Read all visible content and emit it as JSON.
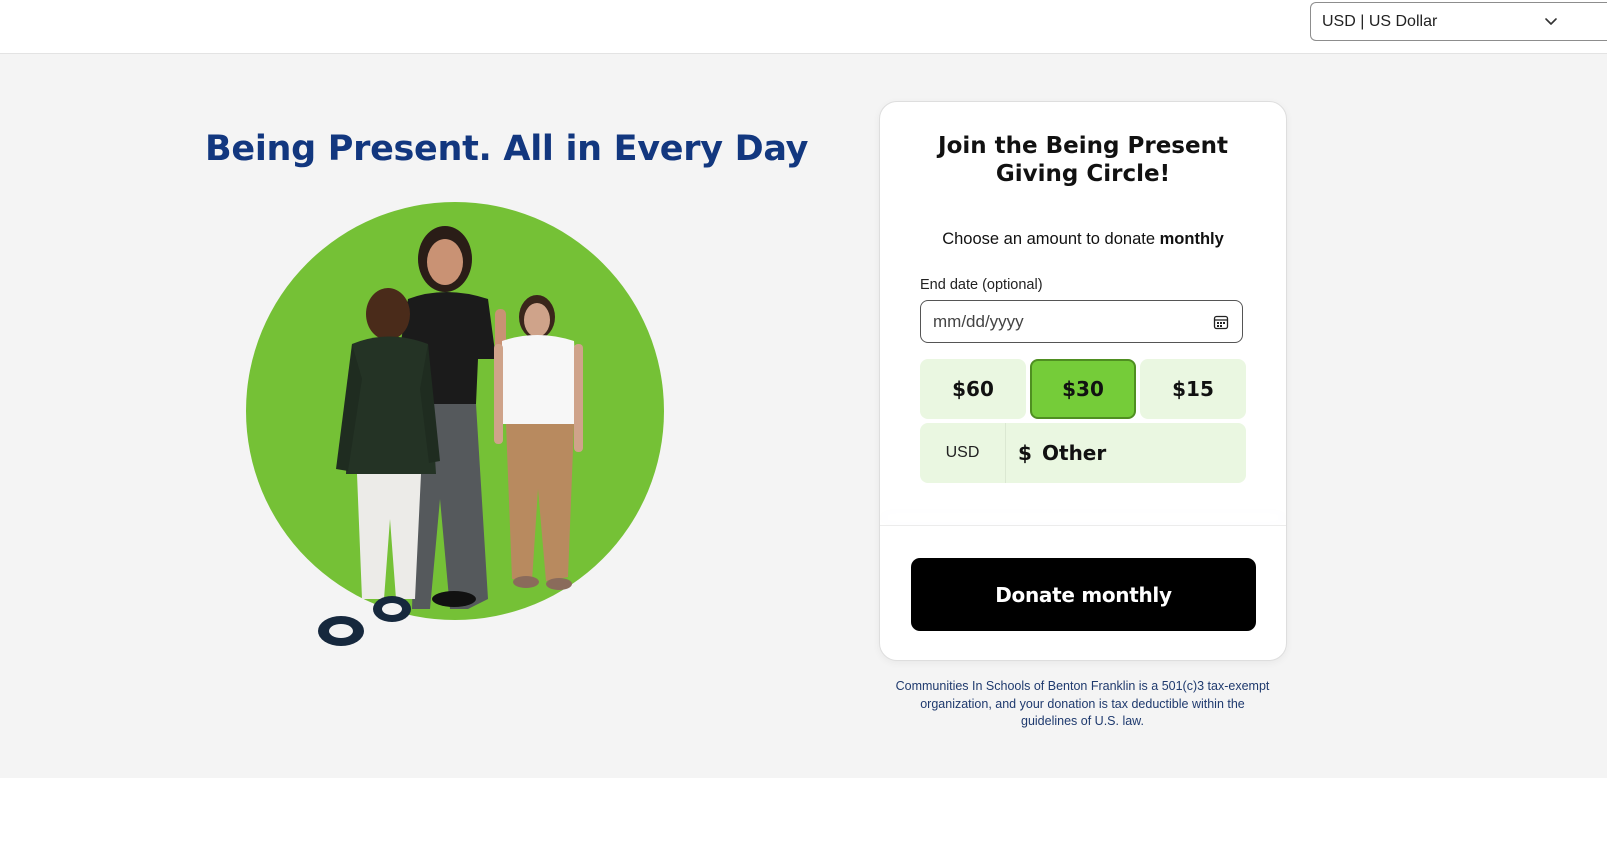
{
  "header": {
    "currency_selector": {
      "value": "USD | US Dollar",
      "icon": "chevron-down-icon"
    }
  },
  "hero": {
    "headline": "Being Present. All in Every Day",
    "image": {
      "description": "hero-photo",
      "circle_color": "#75c136"
    }
  },
  "form": {
    "title": "Join the Being Present Giving Circle!",
    "choose_prefix": "Choose an amount to donate ",
    "choose_emphasis": "monthly",
    "end_date": {
      "label": "End date (optional)",
      "placeholder": "mm/dd/yyyy",
      "icon": "calendar-icon"
    },
    "amounts": [
      {
        "label": "$60",
        "selected": false
      },
      {
        "label": "$30",
        "selected": true
      },
      {
        "label": "$15",
        "selected": false
      }
    ],
    "other": {
      "currency": "USD",
      "symbol": "$",
      "placeholder": "Other"
    },
    "submit_label": "Donate monthly"
  },
  "footer": {
    "disclaimer": "Communities In Schools of Benton Franklin is a 501(c)3 tax-exempt organization, and your donation is tax deductible within the guidelines of U.S. law."
  },
  "colors": {
    "headline": "#12377f",
    "accent_green": "#75cc39",
    "amount_bg": "#eaf7e1",
    "button_bg": "#000000",
    "page_bg": "#f4f4f4"
  }
}
